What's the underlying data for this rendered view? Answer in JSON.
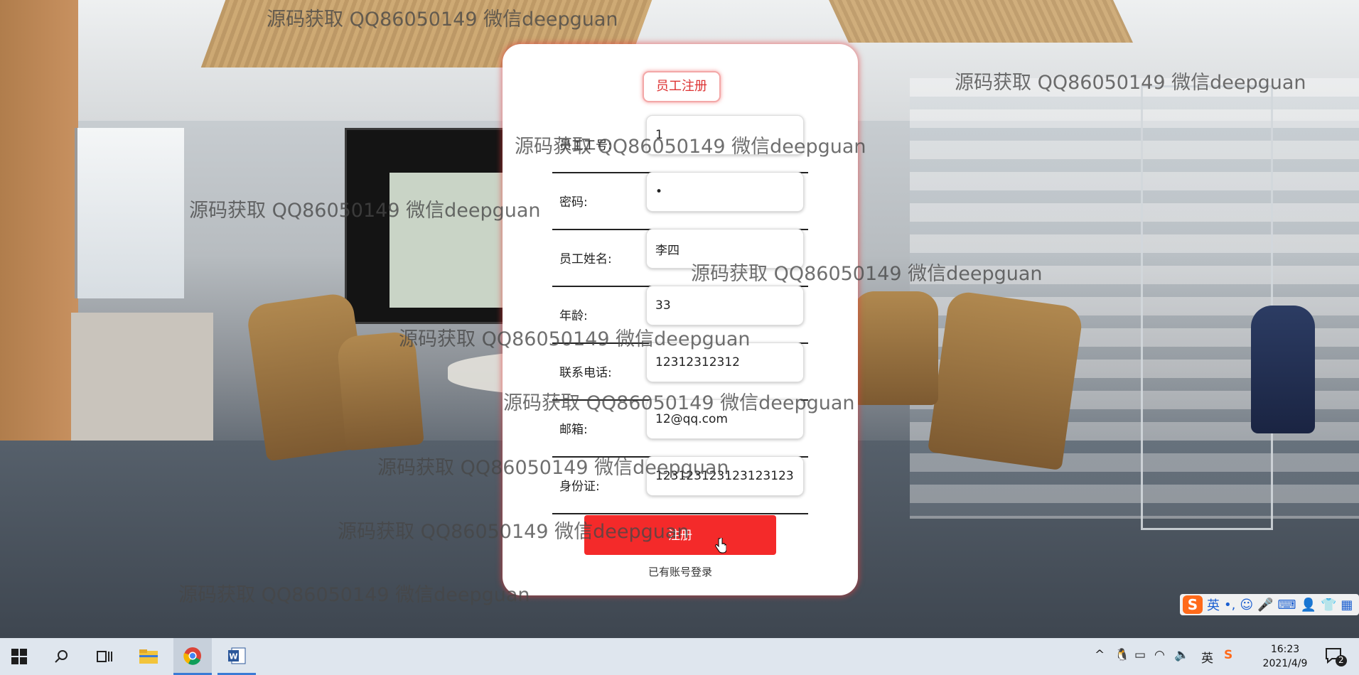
{
  "watermark_text": "源码获取 QQ86050149 微信deepguan",
  "form": {
    "title": "员工注册",
    "fields": [
      {
        "label": "员工工号:",
        "value": "1"
      },
      {
        "label": "密码:",
        "value": "•"
      },
      {
        "label": "员工姓名:",
        "value": "李四"
      },
      {
        "label": "年龄:",
        "value": "33"
      },
      {
        "label": "联系电话:",
        "value": "12312312312"
      },
      {
        "label": "邮箱:",
        "value": "12@qq.com"
      },
      {
        "label": "身份证:",
        "value": "123123123123123123"
      }
    ],
    "submit_label": "注册",
    "login_link": "已有账号登录"
  },
  "ime": {
    "logo": "S",
    "mode": "英"
  },
  "taskbar": {
    "items": [
      "start-icon",
      "search-icon",
      "task-view-icon",
      "file-explorer-icon",
      "chrome-icon",
      "word-icon"
    ],
    "tray_lang": "英",
    "time": "16:23",
    "date": "2021/4/9",
    "notification_count": "2"
  },
  "colors": {
    "accent": "#f42a2a",
    "title": "#dd3333",
    "taskbar": "#dfe6ee"
  }
}
